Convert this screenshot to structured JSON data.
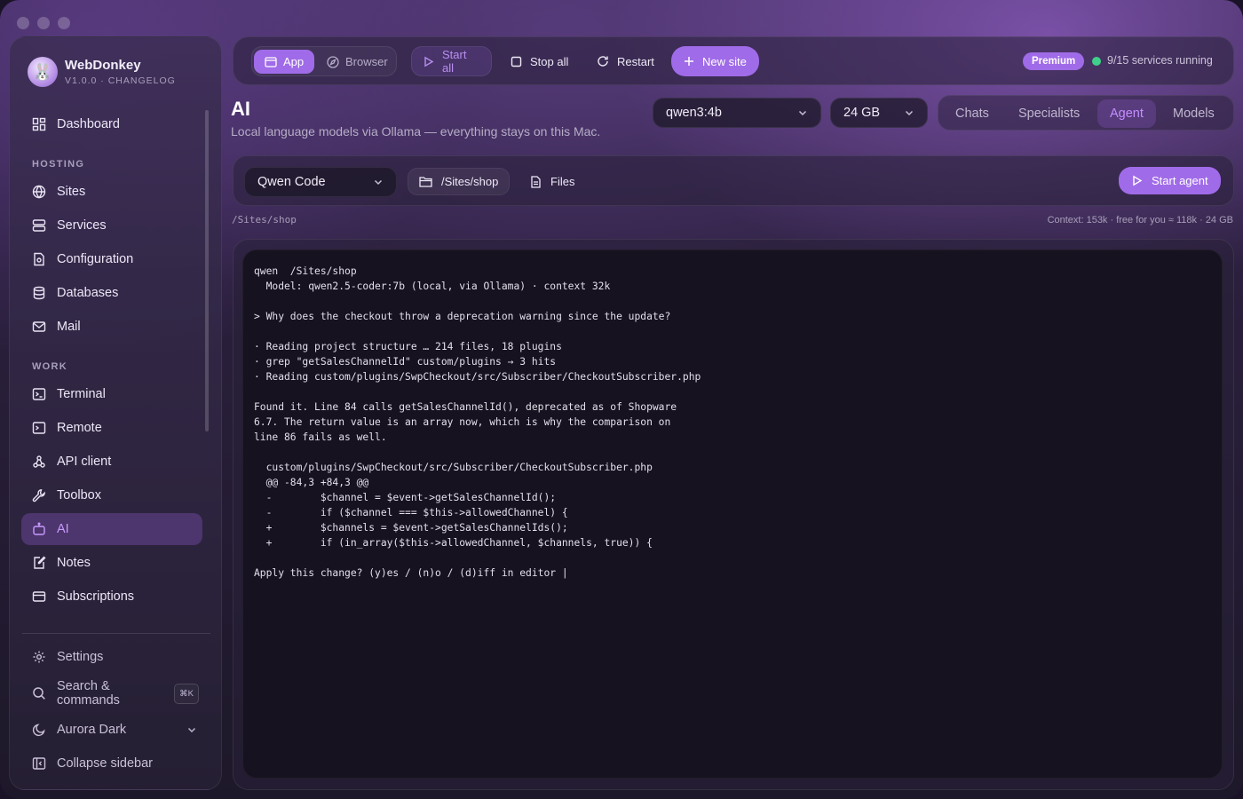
{
  "app": {
    "name": "WebDonkey",
    "version": "V1.0.0 · CHANGELOG"
  },
  "sidebar": {
    "top_item": {
      "label": "Dashboard",
      "icon": "dashboard-icon"
    },
    "sections": [
      {
        "title": "HOSTING",
        "items": [
          {
            "label": "Sites",
            "icon": "globe-icon"
          },
          {
            "label": "Services",
            "icon": "server-icon"
          },
          {
            "label": "Configuration",
            "icon": "config-file-icon"
          },
          {
            "label": "Databases",
            "icon": "database-icon"
          },
          {
            "label": "Mail",
            "icon": "mail-icon"
          }
        ]
      },
      {
        "title": "WORK",
        "items": [
          {
            "label": "Terminal",
            "icon": "terminal-icon"
          },
          {
            "label": "Remote",
            "icon": "remote-icon"
          },
          {
            "label": "API client",
            "icon": "api-icon"
          },
          {
            "label": "Toolbox",
            "icon": "wrench-icon"
          },
          {
            "label": "AI",
            "icon": "robot-icon",
            "active": true
          },
          {
            "label": "Notes",
            "icon": "notes-icon"
          },
          {
            "label": "Subscriptions",
            "icon": "card-icon"
          }
        ]
      }
    ],
    "footer": {
      "settings": "Settings",
      "search": "Search & commands",
      "search_shortcut": "⌘K",
      "theme": "Aurora Dark",
      "collapse": "Collapse sidebar"
    }
  },
  "toolbar": {
    "mode_app": "App",
    "mode_browser": "Browser",
    "start_all": "Start all",
    "stop_all": "Stop all",
    "restart": "Restart",
    "new_site": "New site",
    "premium": "Premium",
    "status": "9/15 services running",
    "status_color": "#3ed08b"
  },
  "page": {
    "title": "AI",
    "subtitle": "Local language models via Ollama — everything stays on this Mac.",
    "model_select": "qwen3:4b",
    "memory_select": "24 GB",
    "tabs": [
      "Chats",
      "Specialists",
      "Agent",
      "Models"
    ],
    "active_tab": "Agent"
  },
  "agent": {
    "tool_select": "Qwen Code",
    "folder": "/Sites/shop",
    "files_button": "Files",
    "start_button": "Start agent",
    "path_label": "/Sites/shop",
    "context_info": "Context: 153k · free for you ≈ 118k · 24 GB"
  },
  "terminal": {
    "lines": [
      "qwen  /Sites/shop",
      "  Model: qwen2.5-coder:7b (local, via Ollama) · context 32k",
      "",
      "> Why does the checkout throw a deprecation warning since the update?",
      "",
      "· Reading project structure … 214 files, 18 plugins",
      "· grep \"getSalesChannelId\" custom/plugins → 3 hits",
      "· Reading custom/plugins/SwpCheckout/src/Subscriber/CheckoutSubscriber.php",
      "",
      "Found it. Line 84 calls getSalesChannelId(), deprecated as of Shopware",
      "6.7. The return value is an array now, which is why the comparison on",
      "line 86 fails as well.",
      "",
      "  custom/plugins/SwpCheckout/src/Subscriber/CheckoutSubscriber.php",
      "  @@ -84,3 +84,3 @@",
      "  -        $channel = $event->getSalesChannelId();",
      "  -        if ($channel === $this->allowedChannel) {",
      "  +        $channels = $event->getSalesChannelIds();",
      "  +        if (in_array($this->allowedChannel, $channels, true)) {",
      "",
      "Apply this change? (y)es / (n)o / (d)iff in editor |"
    ]
  },
  "colors": {
    "accent": "#a06be8",
    "active_text": "#c48dff",
    "terminal_bg": "#17121f"
  }
}
